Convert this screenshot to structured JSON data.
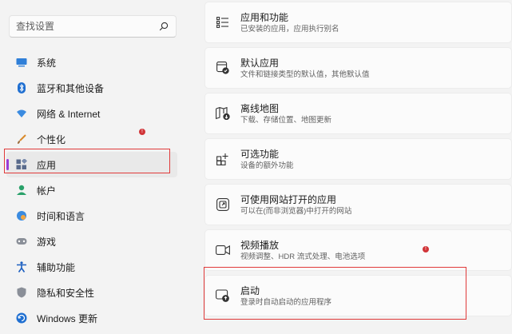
{
  "search": {
    "placeholder": "查找设置",
    "icon": "search-icon"
  },
  "sidebar": {
    "items": [
      {
        "label": "系统",
        "icon": "system-icon"
      },
      {
        "label": "蓝牙和其他设备",
        "icon": "bluetooth-icon"
      },
      {
        "label": "网络 & Internet",
        "icon": "wifi-icon"
      },
      {
        "label": "个性化",
        "icon": "brush-icon",
        "badge": "!"
      },
      {
        "label": "应用",
        "icon": "apps-icon",
        "selected": true
      },
      {
        "label": "帐户",
        "icon": "account-icon"
      },
      {
        "label": "时间和语言",
        "icon": "globe-clock-icon"
      },
      {
        "label": "游戏",
        "icon": "gamepad-icon"
      },
      {
        "label": "辅助功能",
        "icon": "accessibility-icon"
      },
      {
        "label": "隐私和安全性",
        "icon": "shield-icon"
      },
      {
        "label": "Windows 更新",
        "icon": "windows-update-icon"
      }
    ]
  },
  "main": {
    "cards": [
      {
        "title": "应用和功能",
        "subtitle": "已安装的应用，应用执行别名",
        "icon": "apps-list-icon"
      },
      {
        "title": "默认应用",
        "subtitle": "文件和链接类型的默认值，其他默认值",
        "icon": "default-apps-icon"
      },
      {
        "title": "离线地图",
        "subtitle": "下载、存储位置、地图更新",
        "icon": "offline-map-icon"
      },
      {
        "title": "可选功能",
        "subtitle": "设备的额外功能",
        "icon": "optional-features-icon"
      },
      {
        "title": "可使用网站打开的应用",
        "subtitle": "可以在(而非浏览器)中打开的网站",
        "icon": "apps-for-websites-icon"
      },
      {
        "title": "视频播放",
        "subtitle": "视频调整、HDR 流式处理、电池选项",
        "icon": "video-playback-icon",
        "badge": "!"
      },
      {
        "title": "启动",
        "subtitle": "登录时自动启动的应用程序",
        "icon": "startup-icon"
      }
    ]
  },
  "colors": {
    "accent": "#9b3cd6",
    "highlight": "#e03a3a",
    "badge": "#d13438"
  }
}
